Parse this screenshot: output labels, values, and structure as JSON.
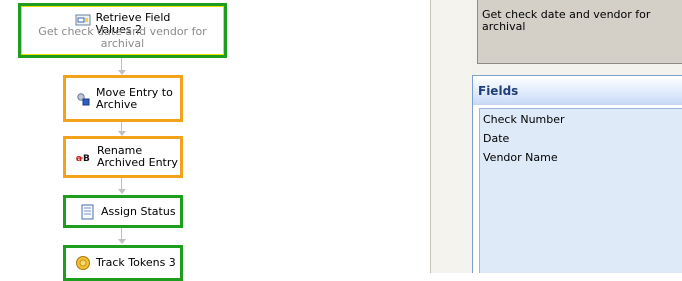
{
  "workflow": {
    "nodes": [
      {
        "title_line1": "Retrieve Field",
        "title_line2": "Values 2",
        "description": "Get check date and vendor for archival",
        "icon": "form-field-icon",
        "border": "#1e9e1e"
      },
      {
        "title_line1": "Move Entry to",
        "title_line2": "Archive",
        "icon": "move-entry-icon",
        "border": "#f2a31b"
      },
      {
        "title_line1": "Rename",
        "title_line2": "Archived Entry",
        "icon": "rename-icon",
        "border": "#f2a31b"
      },
      {
        "title_line1": "Assign Status",
        "icon": "document-icon",
        "border": "#1e9e1e"
      },
      {
        "title_line1": "Track Tokens 3",
        "icon": "token-icon",
        "border": "#1e9e1e"
      }
    ]
  },
  "properties": {
    "description_text": "Get check date and vendor for archival",
    "fields_header": "Fields",
    "fields": [
      "Check Number",
      "Date",
      "Vendor Name"
    ],
    "accent_color": "#1f3f7a"
  }
}
